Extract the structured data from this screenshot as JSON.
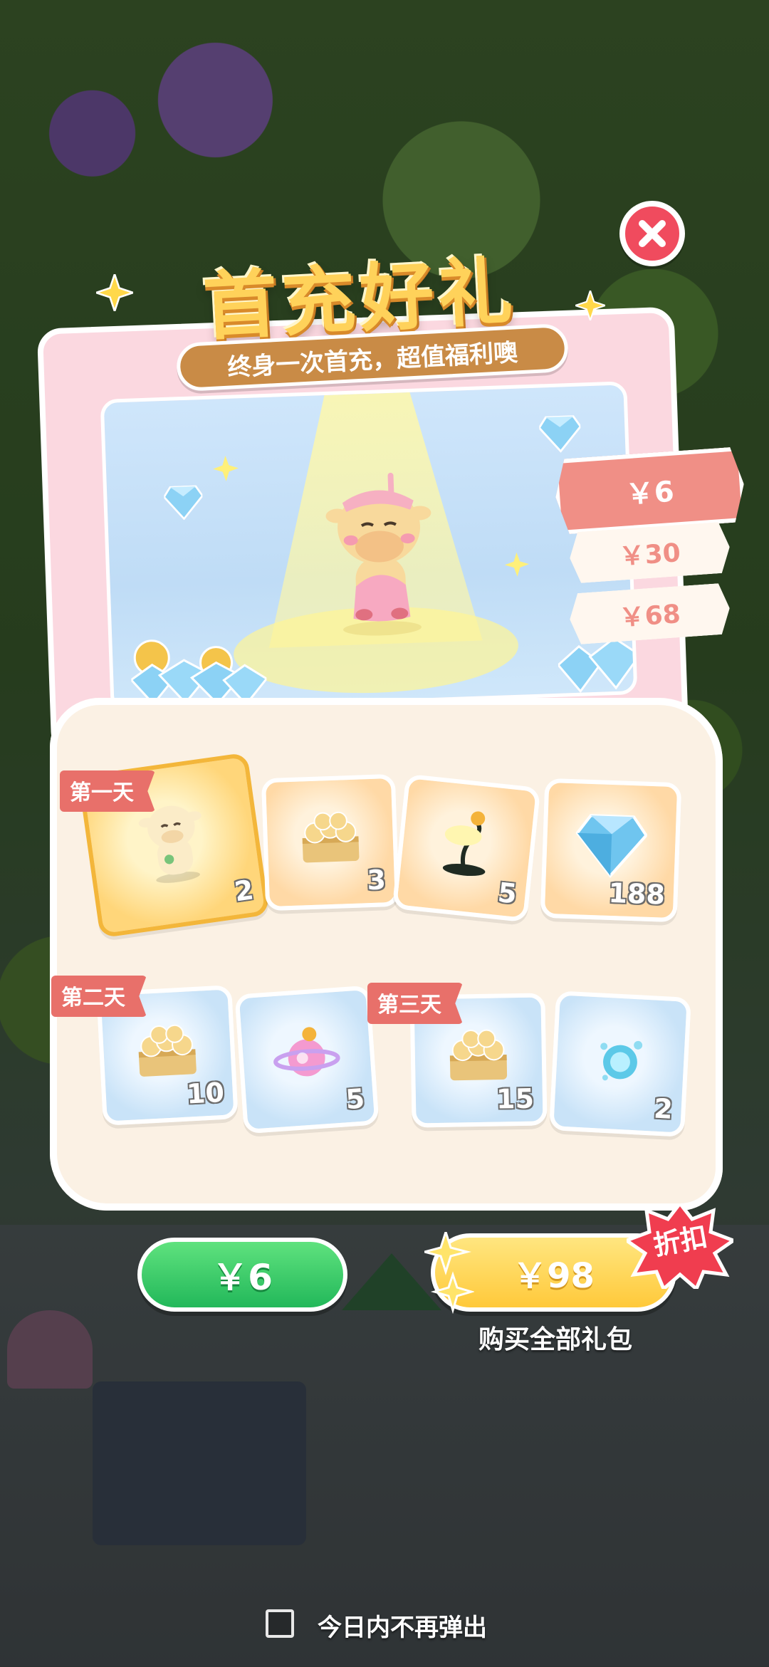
{
  "popup": {
    "title": "首充好礼",
    "subtitle": "终身一次首充，超值福利噢",
    "close_icon": "close-icon"
  },
  "price_tiers": [
    {
      "label": "￥6",
      "selected": true
    },
    {
      "label": "￥30",
      "selected": false
    },
    {
      "label": "￥68",
      "selected": false
    }
  ],
  "days": {
    "day1": {
      "label": "第一天",
      "items": [
        {
          "icon": "cow-figurine-icon",
          "qty": "2"
        },
        {
          "icon": "coin-cake-icon",
          "qty": "3"
        },
        {
          "icon": "lamp-icon",
          "qty": "5"
        },
        {
          "icon": "diamond-icon",
          "qty": "188"
        }
      ]
    },
    "day2": {
      "label": "第二天",
      "items": [
        {
          "icon": "coin-cake-icon",
          "qty": "10"
        },
        {
          "icon": "planet-candy-icon",
          "qty": "5"
        }
      ]
    },
    "day3": {
      "label": "第三天",
      "items": [
        {
          "icon": "coin-cake-icon",
          "qty": "15"
        },
        {
          "icon": "water-orb-icon",
          "qty": "2"
        }
      ]
    }
  },
  "buttons": {
    "buy_label": "￥6",
    "buy_all_label": "￥98",
    "discount_badge": "折扣",
    "buy_all_caption": "购买全部礼包"
  },
  "footer": {
    "dont_show_today": "今日内不再弹出",
    "checked": false
  },
  "colors": {
    "green_button": "#22b85a",
    "yellow_button": "#ffc93a",
    "close_red": "#f04b5e",
    "tag_red": "#e8706a",
    "selected_price": "#f08f86"
  }
}
